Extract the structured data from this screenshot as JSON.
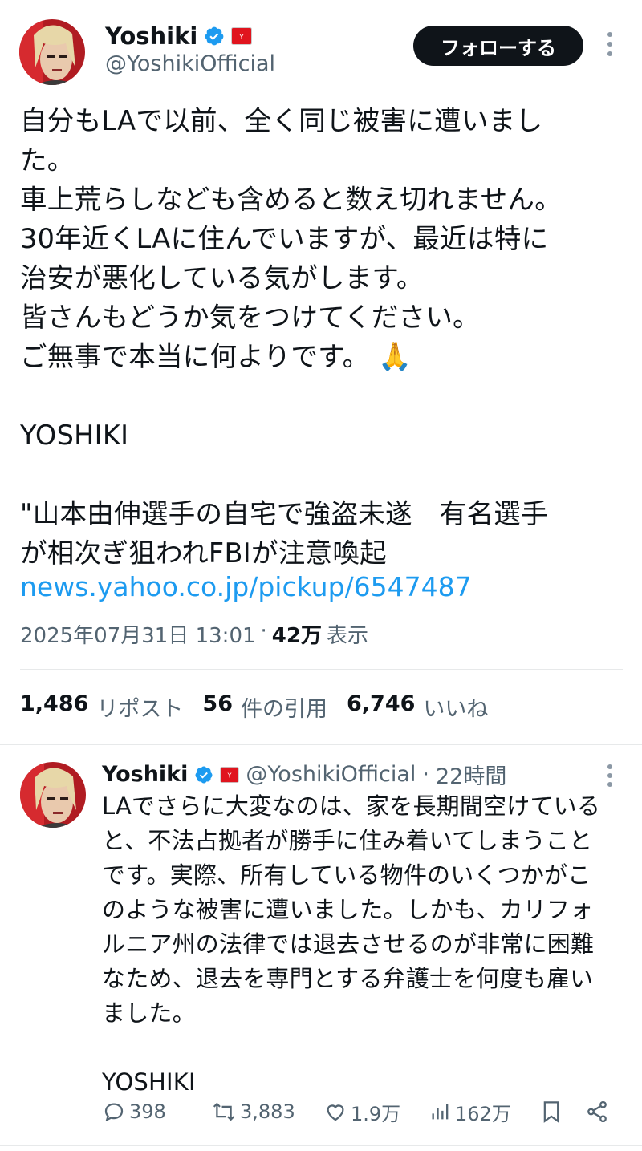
{
  "main_tweet": {
    "author": {
      "display_name": "Yoshiki",
      "handle": "@YoshikiOfficial",
      "verified": true,
      "affiliation_badge_color": "#e0141e"
    },
    "follow_button_label": "フォローする",
    "text_lines": [
      "自分もLAで以前、全く同じ被害に遭いまし",
      "た。",
      "車上荒らしなども含めると数え切れません。",
      "30年近くLAに住んでいますが、最近は特に",
      "治安が悪化している気がします。",
      "皆さんもどうか気をつけてください。",
      "ご無事で本当に何よりです。 🙏",
      "",
      "YOSHIKI",
      "",
      "\"山本由伸選手の自宅で強盗未遂　有名選手",
      "が相次ぎ狙われFBIが注意喚起"
    ],
    "link": "news.yahoo.co.jp/pickup/6547487",
    "timestamp": "2025年07月31日 13:01",
    "separator": "·",
    "views_count": "42万",
    "views_label": "表示",
    "stats": {
      "reposts_count": "1,486",
      "reposts_label": "リポスト",
      "quotes_count": "56",
      "quotes_label": "件の引用",
      "likes_count": "6,746",
      "likes_label": "いいね"
    }
  },
  "reply_tweet": {
    "author": {
      "display_name": "Yoshiki",
      "handle": "@YoshikiOfficial",
      "separator": "·",
      "time_ago": "22時間"
    },
    "text_lines": [
      "LAでさらに大変なのは、家を長期間空けている",
      "と、不法占拠者が勝手に住み着いてしまうこと",
      "です。実際、所有している物件のいくつかがこ",
      "のような被害に遭いました。しかも、カリフォ",
      "ルニア州の法律では退去させるのが非常に困難",
      "なため、退去を専門とする弁護士を何度も雇い",
      "ました。",
      "",
      "YOSHIKI"
    ],
    "actions": {
      "replies": "398",
      "retweets": "3,883",
      "likes": "1.9万",
      "views": "162万"
    }
  },
  "colors": {
    "link": "#1d9bf0",
    "secondary_text": "#536471",
    "verified": "#1d9bf0",
    "divider": "#e7e9ea"
  },
  "icons": [
    "verified-badge-icon",
    "affiliation-badge-icon",
    "more-options-icon",
    "reply-icon",
    "retweet-icon",
    "like-icon",
    "views-icon",
    "bookmark-icon",
    "share-icon"
  ]
}
